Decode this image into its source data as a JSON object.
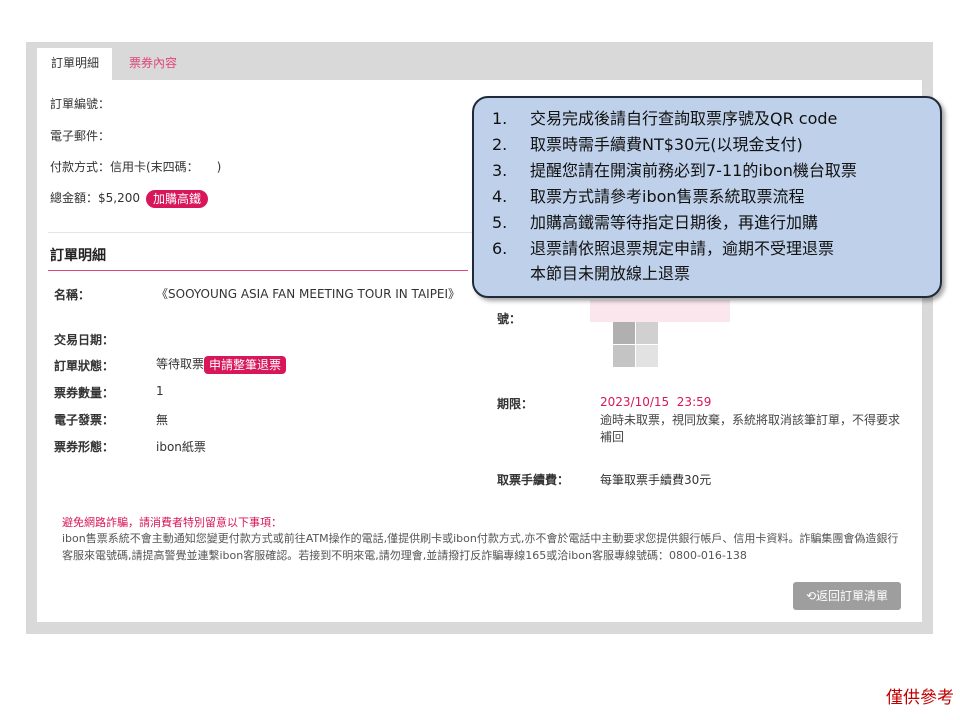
{
  "tabs": {
    "order_detail": "訂單明細",
    "ticket_content": "票券內容"
  },
  "order_info": {
    "order_no_label": "訂單編號：",
    "email_label": "電子郵件：",
    "payment_label": "付款方式：信用卡(末四碼：　　)",
    "total_label": "總金額：$5,200",
    "hsr_badge": "加購高鐵"
  },
  "detail": {
    "section_title": "訂單明細",
    "name_label": "名稱：",
    "name_value": "《SOOYOUNG ASIA FAN MEETING TOUR IN TAIPEI》",
    "date_label": "交易日期：",
    "status_label": "訂單狀態：",
    "status_value": "等待取票",
    "refund_badge": "申請整筆退票",
    "qty_label": "票券數量：",
    "qty_value": "1",
    "invoice_label": "電子發票：",
    "invoice_value": "無",
    "form_label": "票券形態：",
    "form_value": "ibon紙票"
  },
  "right": {
    "partial_label": "號：",
    "deadline_label": "期限：",
    "deadline_value": "2023/10/15  23:59",
    "deadline_note": "逾時未取票，視同放棄，系統將取消該筆訂單，不得要求補回",
    "fee_label": "取票手續費：",
    "fee_value": "每筆取票手續費30元"
  },
  "notice": {
    "title": "避免網路詐騙，請消費者特別留意以下事項：",
    "body": "ibon售票系統不會主動通知您變更付款方式或前往ATM操作的電話,僅提供刷卡或ibon付款方式,亦不會於電話中主動要求您提供銀行帳戶、信用卡資料。詐騙集團會偽造銀行客服來電號碼,請提高警覺並連繫ibon客服確認。若接到不明來電,請勿理會,並請撥打反詐騙專線165或洽ibon客服專線號碼：0800-016-138"
  },
  "back_button": "返回訂單清單",
  "callout": {
    "items": [
      {
        "num": "1.",
        "text": "交易完成後請自行查詢取票序號及QR code"
      },
      {
        "num": "2.",
        "text": "取票時需手續費NT$30元(以現金支付)"
      },
      {
        "num": "3.",
        "text": "提醒您請在開演前務必到7-11的ibon機台取票"
      },
      {
        "num": "4.",
        "text": "取票方式請參考ibon售票系統取票流程"
      },
      {
        "num": "5.",
        "text": "加購高鐵需等待指定日期後，再進行加購"
      },
      {
        "num": "6.",
        "text": "退票請依照退票規定申請，逾期不受理退票"
      }
    ],
    "extra": "本節目未開放線上退票"
  },
  "reference_note": "僅供參考",
  "colors": {
    "accent": "#d8165a",
    "callout_bg": "#bfd1ea",
    "ref_red": "#c00000"
  }
}
